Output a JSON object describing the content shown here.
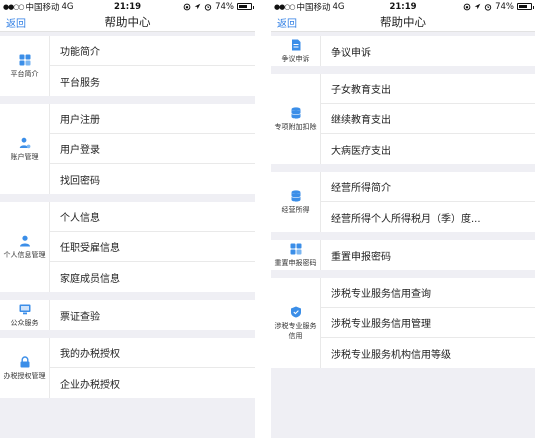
{
  "status_bar": {
    "signal_dots": "●●○○",
    "carrier": "中国移动",
    "network": "4G",
    "time": "21:19",
    "battery_percent": "74%",
    "battery_level": 0.74
  },
  "colors": {
    "accent": "#2f7ee4",
    "background": "#efeff4"
  },
  "left_screen": {
    "nav": {
      "back_label": "返回",
      "title": "帮助中心"
    },
    "sections": [
      {
        "category": "平台简介",
        "icon": "grid-icon",
        "items": [
          "功能简介",
          "平台服务"
        ]
      },
      {
        "category": "账户管理",
        "icon": "user-gear-icon",
        "items": [
          "用户注册",
          "用户登录",
          "找回密码"
        ]
      },
      {
        "category": "个人信息管理",
        "icon": "person-icon",
        "items": [
          "个人信息",
          "任职受雇信息",
          "家庭成员信息"
        ]
      },
      {
        "category": "公众服务",
        "icon": "monitor-icon",
        "items": [
          "票证查验"
        ]
      },
      {
        "category": "办税授权管理",
        "icon": "lock-icon",
        "items": [
          "我的办税授权",
          "企业办税授权"
        ]
      }
    ]
  },
  "right_screen": {
    "nav": {
      "back_label": "返回",
      "title": "帮助中心"
    },
    "sections": [
      {
        "category": "争议申诉",
        "icon": "document-icon",
        "items": [
          "争议申诉"
        ]
      },
      {
        "category": "专项附加扣除",
        "icon": "database-icon",
        "items": [
          "子女教育支出",
          "继续教育支出",
          "大病医疗支出"
        ]
      },
      {
        "category": "经营所得",
        "icon": "database-icon",
        "items": [
          "经营所得简介",
          "经营所得个人所得税月（季）度..."
        ]
      },
      {
        "category": "重置申报密码",
        "icon": "grid-icon",
        "items": [
          "重置申报密码"
        ]
      },
      {
        "category": "涉税专业服务信用",
        "icon": "shield-icon",
        "items": [
          "涉税专业服务信用查询",
          "涉税专业服务信用管理",
          "涉税专业服务机构信用等级"
        ]
      }
    ]
  }
}
